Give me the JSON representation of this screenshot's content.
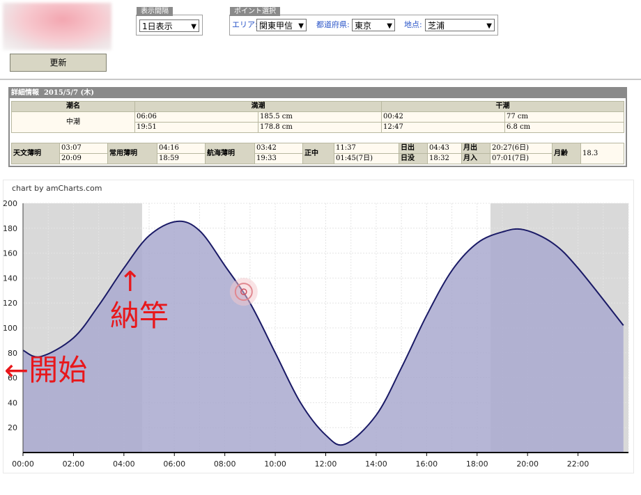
{
  "controls": {
    "interval_group_label": "表示間隔",
    "interval_value": "1日表示",
    "point_group_label": "ポイント選択",
    "area_label": "エリア:",
    "area_value": "関東甲信",
    "pref_label": "都道府県:",
    "pref_value": "東京",
    "spot_label": "地点:",
    "spot_value": "芝浦",
    "update_button": "更新"
  },
  "detail": {
    "title": "詳細情報",
    "date": "2015/5/7 (木)",
    "headers": {
      "tide_name": "潮名",
      "high": "満潮",
      "low": "干潮"
    },
    "tide_name": "中潮",
    "high_tides": [
      {
        "time": "06:06",
        "level": "185.5 cm"
      },
      {
        "time": "19:51",
        "level": "178.8 cm"
      }
    ],
    "low_tides": [
      {
        "time": "00:42",
        "level": "77 cm"
      },
      {
        "time": "12:47",
        "level": "6.8 cm"
      }
    ],
    "astro": {
      "astro_twilight_label": "天文薄明",
      "astro_twilight": [
        "03:07",
        "20:09"
      ],
      "civil_twilight_label": "常用薄明",
      "civil_twilight": [
        "04:16",
        "18:59"
      ],
      "nautical_twilight_label": "航海薄明",
      "nautical_twilight": [
        "03:42",
        "19:33"
      ],
      "noon_label": "正中",
      "noon": [
        "11:37",
        "01:45(7日)"
      ],
      "sunrise_label": "日出",
      "sunrise": "04:43",
      "sunset_label": "日没",
      "sunset": "18:32",
      "moonrise_label": "月出",
      "moonrise": "20:27(6日)",
      "moonset_label": "月入",
      "moonset": "07:01(7日)",
      "moon_age_label": "月齢",
      "moon_age": "18.3"
    }
  },
  "credit": "chart by amCharts.com",
  "annotations": {
    "start": "←開始",
    "rod": "↑",
    "rod_text": "納竿"
  },
  "colors": {
    "fill": "#a9a9cf",
    "line": "#1a1a66",
    "night": "#d9d9d9",
    "annotation": "#e8171b"
  },
  "chart_data": {
    "type": "area",
    "x_unit": "hour",
    "x": [
      0,
      0.7,
      2,
      3,
      4,
      5,
      6.1,
      7,
      8,
      9,
      10,
      11,
      12,
      12.78,
      14,
      15,
      16,
      17,
      18,
      19,
      19.85,
      21,
      22,
      23.8
    ],
    "y": [
      82,
      77,
      92,
      118,
      148,
      174,
      185.5,
      178,
      150,
      120,
      80,
      40,
      14,
      6.8,
      30,
      68,
      110,
      146,
      168,
      177,
      178.8,
      168,
      148,
      102
    ],
    "xticks": [
      "00:00",
      "02:00",
      "04:00",
      "06:00",
      "08:00",
      "10:00",
      "12:00",
      "14:00",
      "16:00",
      "18:00",
      "20:00",
      "22:00"
    ],
    "xlim": [
      0,
      24
    ],
    "ylim": [
      0,
      200
    ],
    "yticks": [
      "20",
      "40",
      "60",
      "80",
      "100",
      "120",
      "140",
      "160",
      "180",
      "200"
    ],
    "night_bands": [
      [
        0,
        4.72
      ],
      [
        18.53,
        24
      ]
    ],
    "marker": {
      "x": 8.75,
      "y": 129
    },
    "grid": true
  }
}
